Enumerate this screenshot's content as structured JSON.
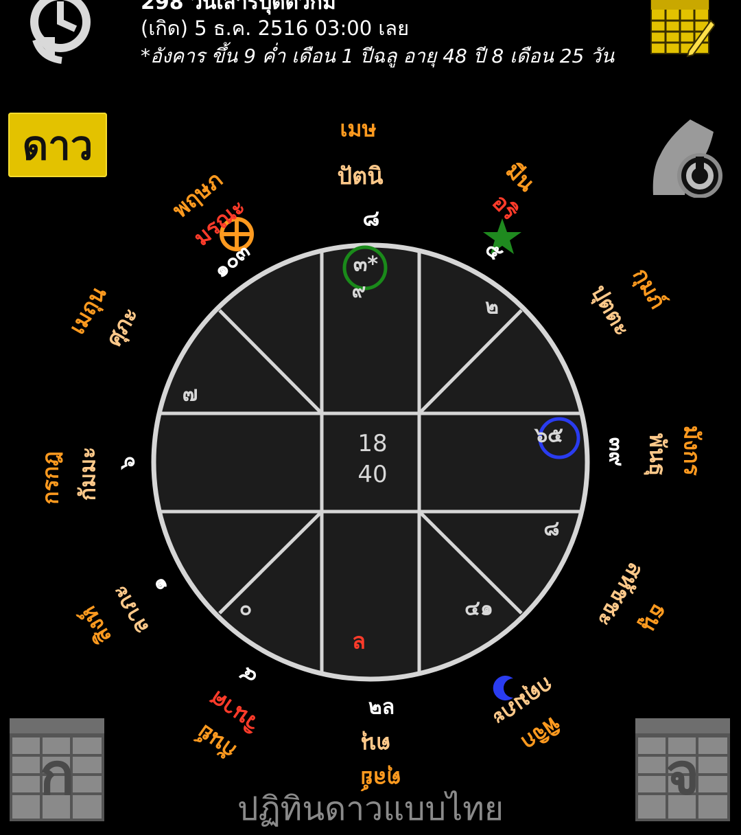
{
  "header": {
    "cut_line": "298 วันเสาร์ปุตติวีกม",
    "birth_line": "(เกิด) 5 ธ.ค. 2516 03:00 เลย",
    "lunar_line": "*อังคาร ขึ้น 9 ค่ำ เดือน 1 ปีฉลู อายุ 48 ปี 8 เดือน 25 วัน"
  },
  "toolbar": {
    "history_icon": "history-icon",
    "calendar_icon": "calendar-edit-icon",
    "dao_label": "ดาว",
    "reset_icon": "reset-head-icon"
  },
  "chart": {
    "center": {
      "top": "18",
      "bottom": "40"
    },
    "cells": {
      "top_center": "๓*",
      "top_center_sub": "๙",
      "top_right": "๒",
      "left_top": "๗",
      "right_mid": "๖๕",
      "right_bottom": "๘",
      "bottom_left": "๐",
      "bottom_right": "๔๑",
      "bottom_center": "ล"
    },
    "rasi": {
      "n": {
        "sign": "เมษ",
        "house": "ปัตนิ",
        "num": "๘"
      },
      "ne": {
        "sign": "มีน",
        "house": "อริ",
        "num": "๕"
      },
      "e1": {
        "sign": "กุมภ์",
        "house": "ปุตตะ"
      },
      "e": {
        "sign": "มังกร",
        "house": "พันธุ",
        "num": "๓๙"
      },
      "e2": {
        "sign": "ธนู",
        "house": "สหัชชะ"
      },
      "se": {
        "sign": "พิจิก",
        "house": "กดุมภะ"
      },
      "s": {
        "sign": "ตุลย์",
        "house": "ตนุ",
        "num": "๒ล"
      },
      "sw": {
        "sign": "กันย์",
        "house": "วินาศ",
        "num": "๔"
      },
      "w2": {
        "sign": "สิงห์",
        "house": "ลาภะ",
        "num": "๑"
      },
      "w": {
        "sign": "กรกฎ",
        "house": "กัมมะ",
        "num": "๖"
      },
      "w1": {
        "sign": "เมถุน",
        "house": "ศุภะ"
      },
      "nw": {
        "sign": "พฤษภ",
        "house": "มรณะ",
        "num": "๑๐๓"
      }
    }
  },
  "nav": {
    "prev_label": "ก",
    "next_label": "จ"
  },
  "footer": {
    "title": "ปฏิทินดาวแบบไทย"
  },
  "colors": {
    "accent_yellow": "#e3c200",
    "orange": "#ff9a1f",
    "red": "#ff3b2a",
    "green_ring": "#1a8a1a",
    "blue_ring": "#2a3cf0"
  }
}
